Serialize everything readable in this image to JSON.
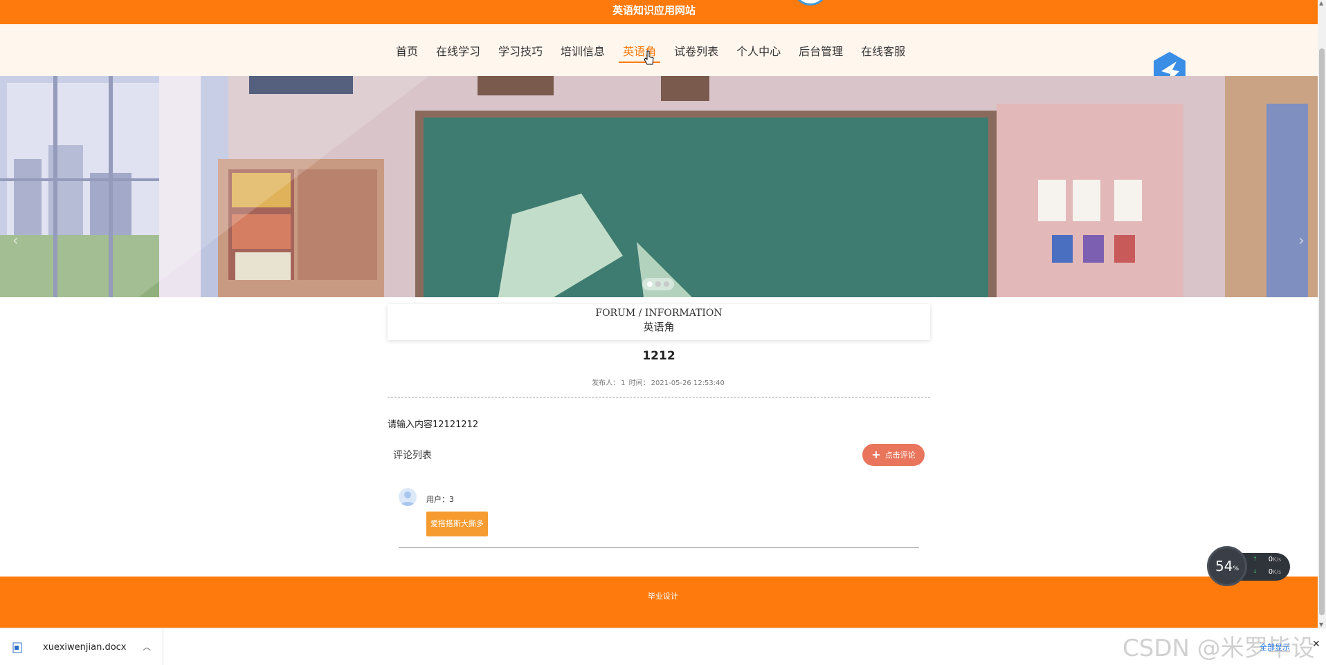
{
  "site": {
    "title": "英语知识应用网站"
  },
  "nav": {
    "items": [
      {
        "label": "首页"
      },
      {
        "label": "在线学习"
      },
      {
        "label": "学习技巧"
      },
      {
        "label": "培训信息"
      },
      {
        "label": "英语角",
        "active": true
      },
      {
        "label": "试卷列表"
      },
      {
        "label": "个人中心"
      },
      {
        "label": "后台管理"
      },
      {
        "label": "在线客服"
      }
    ]
  },
  "banner": {
    "slides": 3,
    "active_slide": 1
  },
  "section": {
    "title_en": "FORUM / INFORMATION",
    "title_cn": "英语角"
  },
  "post": {
    "title": "1212",
    "author_label": "发布人：",
    "author": "1",
    "time_label": "时间：",
    "time": "2021-05-26 12:53:40",
    "content": "请输入内容12121212"
  },
  "comments": {
    "heading": "评论列表",
    "add_button": "点击评论",
    "items": [
      {
        "user_label": "用户：",
        "user": "3",
        "text": "爱搭搭斯大撕多"
      }
    ]
  },
  "footer": {
    "text": "毕业设计"
  },
  "net_widget": {
    "percent": "54",
    "percent_unit": "%",
    "up": "0",
    "down": "0",
    "unit": "K/s"
  },
  "download_bar": {
    "file_name": "xuexiwenjian.docx",
    "show_all": "全部显示"
  },
  "watermark": "CSDN @米罗毕设",
  "colors": {
    "accent": "#ff7a0c",
    "button": "#e9765c",
    "comment_bg": "#f59b2f"
  }
}
